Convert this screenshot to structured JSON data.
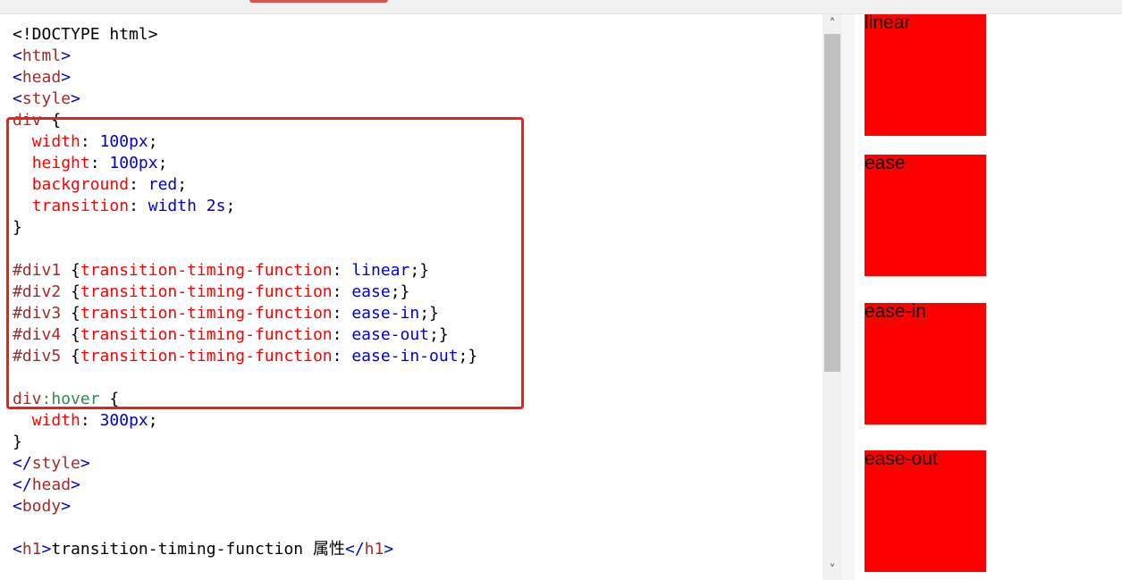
{
  "code_lines": [
    [
      [
        "plain",
        "<!DOCTYPE html>"
      ]
    ],
    [
      [
        "br",
        "<"
      ],
      [
        "tag",
        "html"
      ],
      [
        "br",
        ">"
      ]
    ],
    [
      [
        "br",
        "<"
      ],
      [
        "tag",
        "head"
      ],
      [
        "br",
        ">"
      ]
    ],
    [
      [
        "br",
        "<"
      ],
      [
        "tag",
        "style"
      ],
      [
        "br",
        ">"
      ]
    ],
    [
      [
        "sel",
        "div"
      ],
      [
        "plain",
        " {"
      ]
    ],
    [
      [
        "plain",
        "  "
      ],
      [
        "prop",
        "width"
      ],
      [
        "plain",
        ": "
      ],
      [
        "val",
        "100px"
      ],
      [
        "plain",
        ";"
      ]
    ],
    [
      [
        "plain",
        "  "
      ],
      [
        "prop",
        "height"
      ],
      [
        "plain",
        ": "
      ],
      [
        "val",
        "100px"
      ],
      [
        "plain",
        ";"
      ]
    ],
    [
      [
        "plain",
        "  "
      ],
      [
        "prop",
        "background"
      ],
      [
        "plain",
        ": "
      ],
      [
        "val",
        "red"
      ],
      [
        "plain",
        ";"
      ]
    ],
    [
      [
        "plain",
        "  "
      ],
      [
        "prop",
        "transition"
      ],
      [
        "plain",
        ": "
      ],
      [
        "val",
        "width 2s"
      ],
      [
        "plain",
        ";"
      ]
    ],
    [
      [
        "plain",
        "}"
      ]
    ],
    [
      [
        "plain",
        ""
      ]
    ],
    [
      [
        "sel",
        "#div1"
      ],
      [
        "plain",
        " {"
      ],
      [
        "prop",
        "transition-timing-function"
      ],
      [
        "plain",
        ": "
      ],
      [
        "val",
        "linear"
      ],
      [
        "plain",
        ";}"
      ]
    ],
    [
      [
        "sel",
        "#div2"
      ],
      [
        "plain",
        " {"
      ],
      [
        "prop",
        "transition-timing-function"
      ],
      [
        "plain",
        ": "
      ],
      [
        "val",
        "ease"
      ],
      [
        "plain",
        ";}"
      ]
    ],
    [
      [
        "sel",
        "#div3"
      ],
      [
        "plain",
        " {"
      ],
      [
        "prop",
        "transition-timing-function"
      ],
      [
        "plain",
        ": "
      ],
      [
        "val",
        "ease-in"
      ],
      [
        "plain",
        ";}"
      ]
    ],
    [
      [
        "sel",
        "#div4"
      ],
      [
        "plain",
        " {"
      ],
      [
        "prop",
        "transition-timing-function"
      ],
      [
        "plain",
        ": "
      ],
      [
        "val",
        "ease-out"
      ],
      [
        "plain",
        ";}"
      ]
    ],
    [
      [
        "sel",
        "#div5"
      ],
      [
        "plain",
        " {"
      ],
      [
        "prop",
        "transition-timing-function"
      ],
      [
        "plain",
        ": "
      ],
      [
        "val",
        "ease-in-out"
      ],
      [
        "plain",
        ";}"
      ]
    ],
    [
      [
        "plain",
        ""
      ]
    ],
    [
      [
        "sel",
        "div"
      ],
      [
        "pseudo",
        ":hover"
      ],
      [
        "plain",
        " {"
      ]
    ],
    [
      [
        "plain",
        "  "
      ],
      [
        "prop",
        "width"
      ],
      [
        "plain",
        ": "
      ],
      [
        "val",
        "300px"
      ],
      [
        "plain",
        ";"
      ]
    ],
    [
      [
        "plain",
        "}"
      ]
    ],
    [
      [
        "br",
        "</"
      ],
      [
        "tag",
        "style"
      ],
      [
        "br",
        ">"
      ]
    ],
    [
      [
        "br",
        "</"
      ],
      [
        "tag",
        "head"
      ],
      [
        "br",
        ">"
      ]
    ],
    [
      [
        "br",
        "<"
      ],
      [
        "tag",
        "body"
      ],
      [
        "br",
        ">"
      ]
    ],
    [
      [
        "plain",
        ""
      ]
    ],
    [
      [
        "br",
        "<"
      ],
      [
        "tag",
        "h1"
      ],
      [
        "br",
        ">"
      ],
      [
        "plain",
        "transition-timing-function 属性"
      ],
      [
        "br",
        "</"
      ],
      [
        "tag",
        "h1"
      ],
      [
        "br",
        ">"
      ]
    ]
  ],
  "preview_boxes": [
    {
      "label": "linear"
    },
    {
      "label": "ease"
    },
    {
      "label": "ease-in"
    },
    {
      "label": "ease-out"
    }
  ],
  "scrollbar": {
    "up_icon": "chevron-up-icon",
    "down_icon": "chevron-down-icon",
    "up_glyph": "˄",
    "down_glyph": "˅"
  },
  "colors": {
    "accent": "#e8211d",
    "box": "#ff0000",
    "tag": "#a52a2a",
    "value": "#0000cd",
    "property": "#ff0000"
  }
}
